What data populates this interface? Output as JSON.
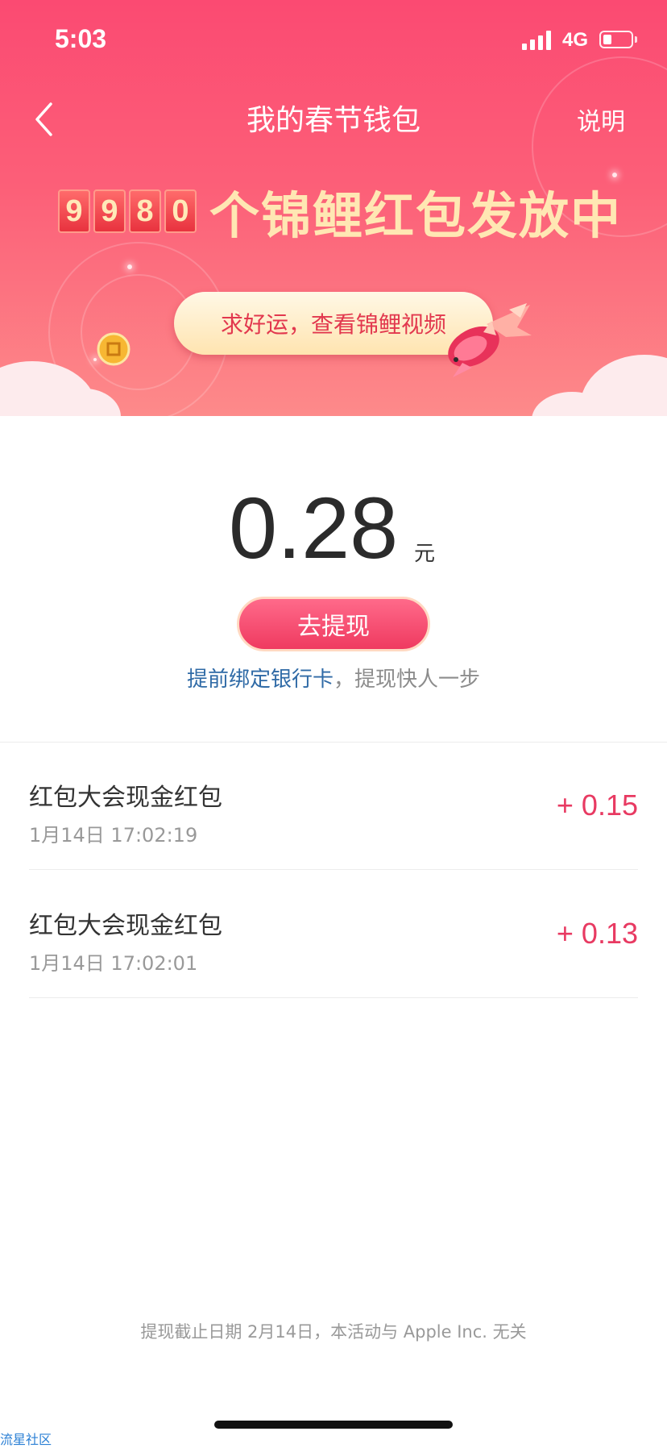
{
  "status_bar": {
    "time": "5:03",
    "network": "4G",
    "battery_level": 0.3
  },
  "nav": {
    "title": "我的春节钱包",
    "help": "说明"
  },
  "banner": {
    "digits": [
      "9",
      "9",
      "8",
      "0"
    ],
    "counter_text": "个锦鲤红包发放中",
    "lucky_button": "求好运，查看锦鲤视频"
  },
  "wallet": {
    "amount": "0.28",
    "unit": "元",
    "withdraw_button": "去提现",
    "bind_link": "提前绑定银行卡",
    "bind_suffix": "，提现快人一步"
  },
  "records": [
    {
      "title": "红包大会现金红包",
      "time": "1月14日 17:02:19",
      "amount": "+ 0.15"
    },
    {
      "title": "红包大会现金红包",
      "time": "1月14日 17:02:01",
      "amount": "+ 0.13"
    }
  ],
  "footer": {
    "note": "提现截止日期 2月14日，本活动与 Apple Inc. 无关"
  },
  "watermark": "流星社区",
  "colors": {
    "brand": "#fb4a72",
    "accent_text": "#e83a62",
    "link": "#2f6aa6",
    "gold": "#ffe7b3"
  },
  "icons": {
    "back": "chevron-left-icon",
    "koi": "koi-fish-icon",
    "coin": "coin-icon"
  }
}
